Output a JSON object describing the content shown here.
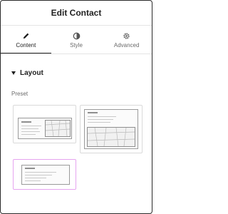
{
  "header": {
    "title": "Edit Contact"
  },
  "tabs": [
    {
      "label": "Content",
      "icon": "pencil-icon",
      "active": true
    },
    {
      "label": "Style",
      "icon": "contrast-icon",
      "active": false
    },
    {
      "label": "Advanced",
      "icon": "gear-icon",
      "active": false
    }
  ],
  "section": {
    "title": "Layout"
  },
  "preset": {
    "label": "Preset",
    "options": [
      {
        "layout": "form-left-map-right",
        "selected": false
      },
      {
        "layout": "form-top-map-bottom",
        "selected": false
      },
      {
        "layout": "form-only",
        "selected": true
      }
    ]
  },
  "colors": {
    "selected_border": "#e6a4f0",
    "text": "#1f1f1f",
    "muted": "#6b6b6b"
  }
}
